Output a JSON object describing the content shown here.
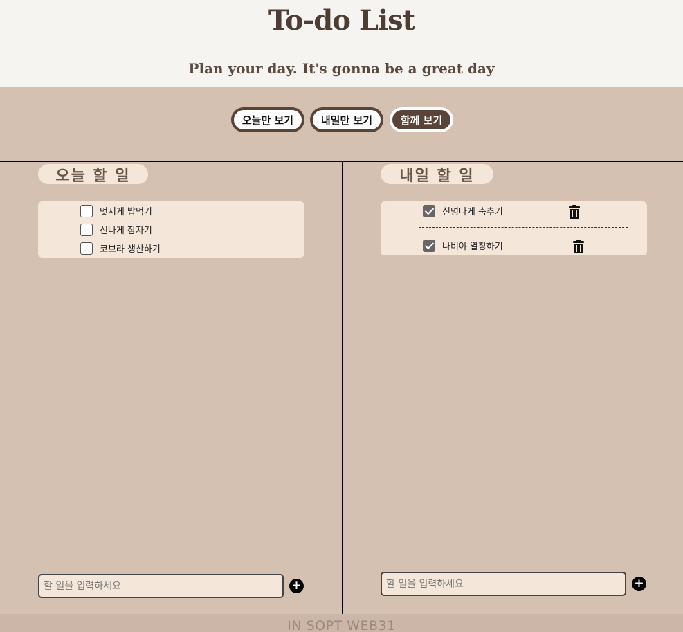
{
  "header": {
    "title": "To-do List",
    "subtitle": "Plan your day. It's gonna be a great day"
  },
  "filters": {
    "today_only": "오늘만 보기",
    "tomorrow_only": "내일만 보기",
    "both": "함께 보기",
    "active": "both"
  },
  "today": {
    "title": "오늘 할 일",
    "items": [
      {
        "text": "멋지게 밥먹기",
        "checked": false
      },
      {
        "text": "신나게 잠자기",
        "checked": false
      },
      {
        "text": "코브라 생산하기",
        "checked": false
      }
    ],
    "input_placeholder": "할 일을 입력하세요",
    "add_label": "+"
  },
  "tomorrow": {
    "title": "내일 할 일",
    "items": [
      {
        "text": "신명나게 춤추기",
        "checked": true
      },
      {
        "text": "나비야 열창하기",
        "checked": true
      }
    ],
    "input_placeholder": "할 일을 입력하세요",
    "add_label": "+"
  },
  "footer": {
    "text": "IN SOPT WEB31"
  },
  "colors": {
    "background": "#d4c1b1",
    "header_bg": "#f5f4f0",
    "card_bg": "#f4e6d9",
    "accent": "#5a4438"
  },
  "icons": {
    "delete": "trash-icon",
    "add": "plus-circle-icon",
    "check": "checkbox-icon"
  }
}
